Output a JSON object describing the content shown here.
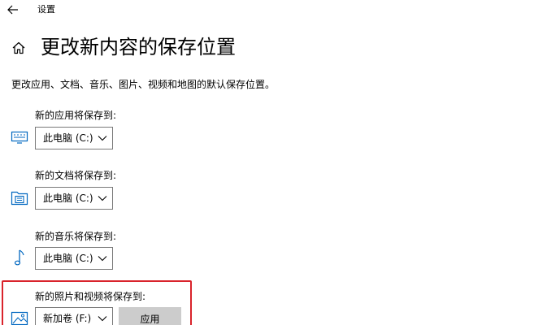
{
  "window": {
    "app_title": "设置"
  },
  "page": {
    "title": "更改新内容的保存位置",
    "description": "更改应用、文档、音乐、图片、视频和地图的默认保存位置。"
  },
  "settings": [
    {
      "label": "新的应用将保存到:",
      "value": "此电脑 (C:)",
      "icon": "monitor-icon"
    },
    {
      "label": "新的文档将保存到:",
      "value": "此电脑 (C:)",
      "icon": "folder-document-icon"
    },
    {
      "label": "新的音乐将保存到:",
      "value": "此电脑 (C:)",
      "icon": "music-note-icon"
    },
    {
      "label": "新的照片和视频将保存到:",
      "value": "新加卷 (F:)",
      "icon": "picture-icon"
    }
  ],
  "apply_button": {
    "label": "应用"
  },
  "colors": {
    "accent": "#0067c0",
    "highlight_border": "#d9232b",
    "button_bg": "#cccccc"
  }
}
